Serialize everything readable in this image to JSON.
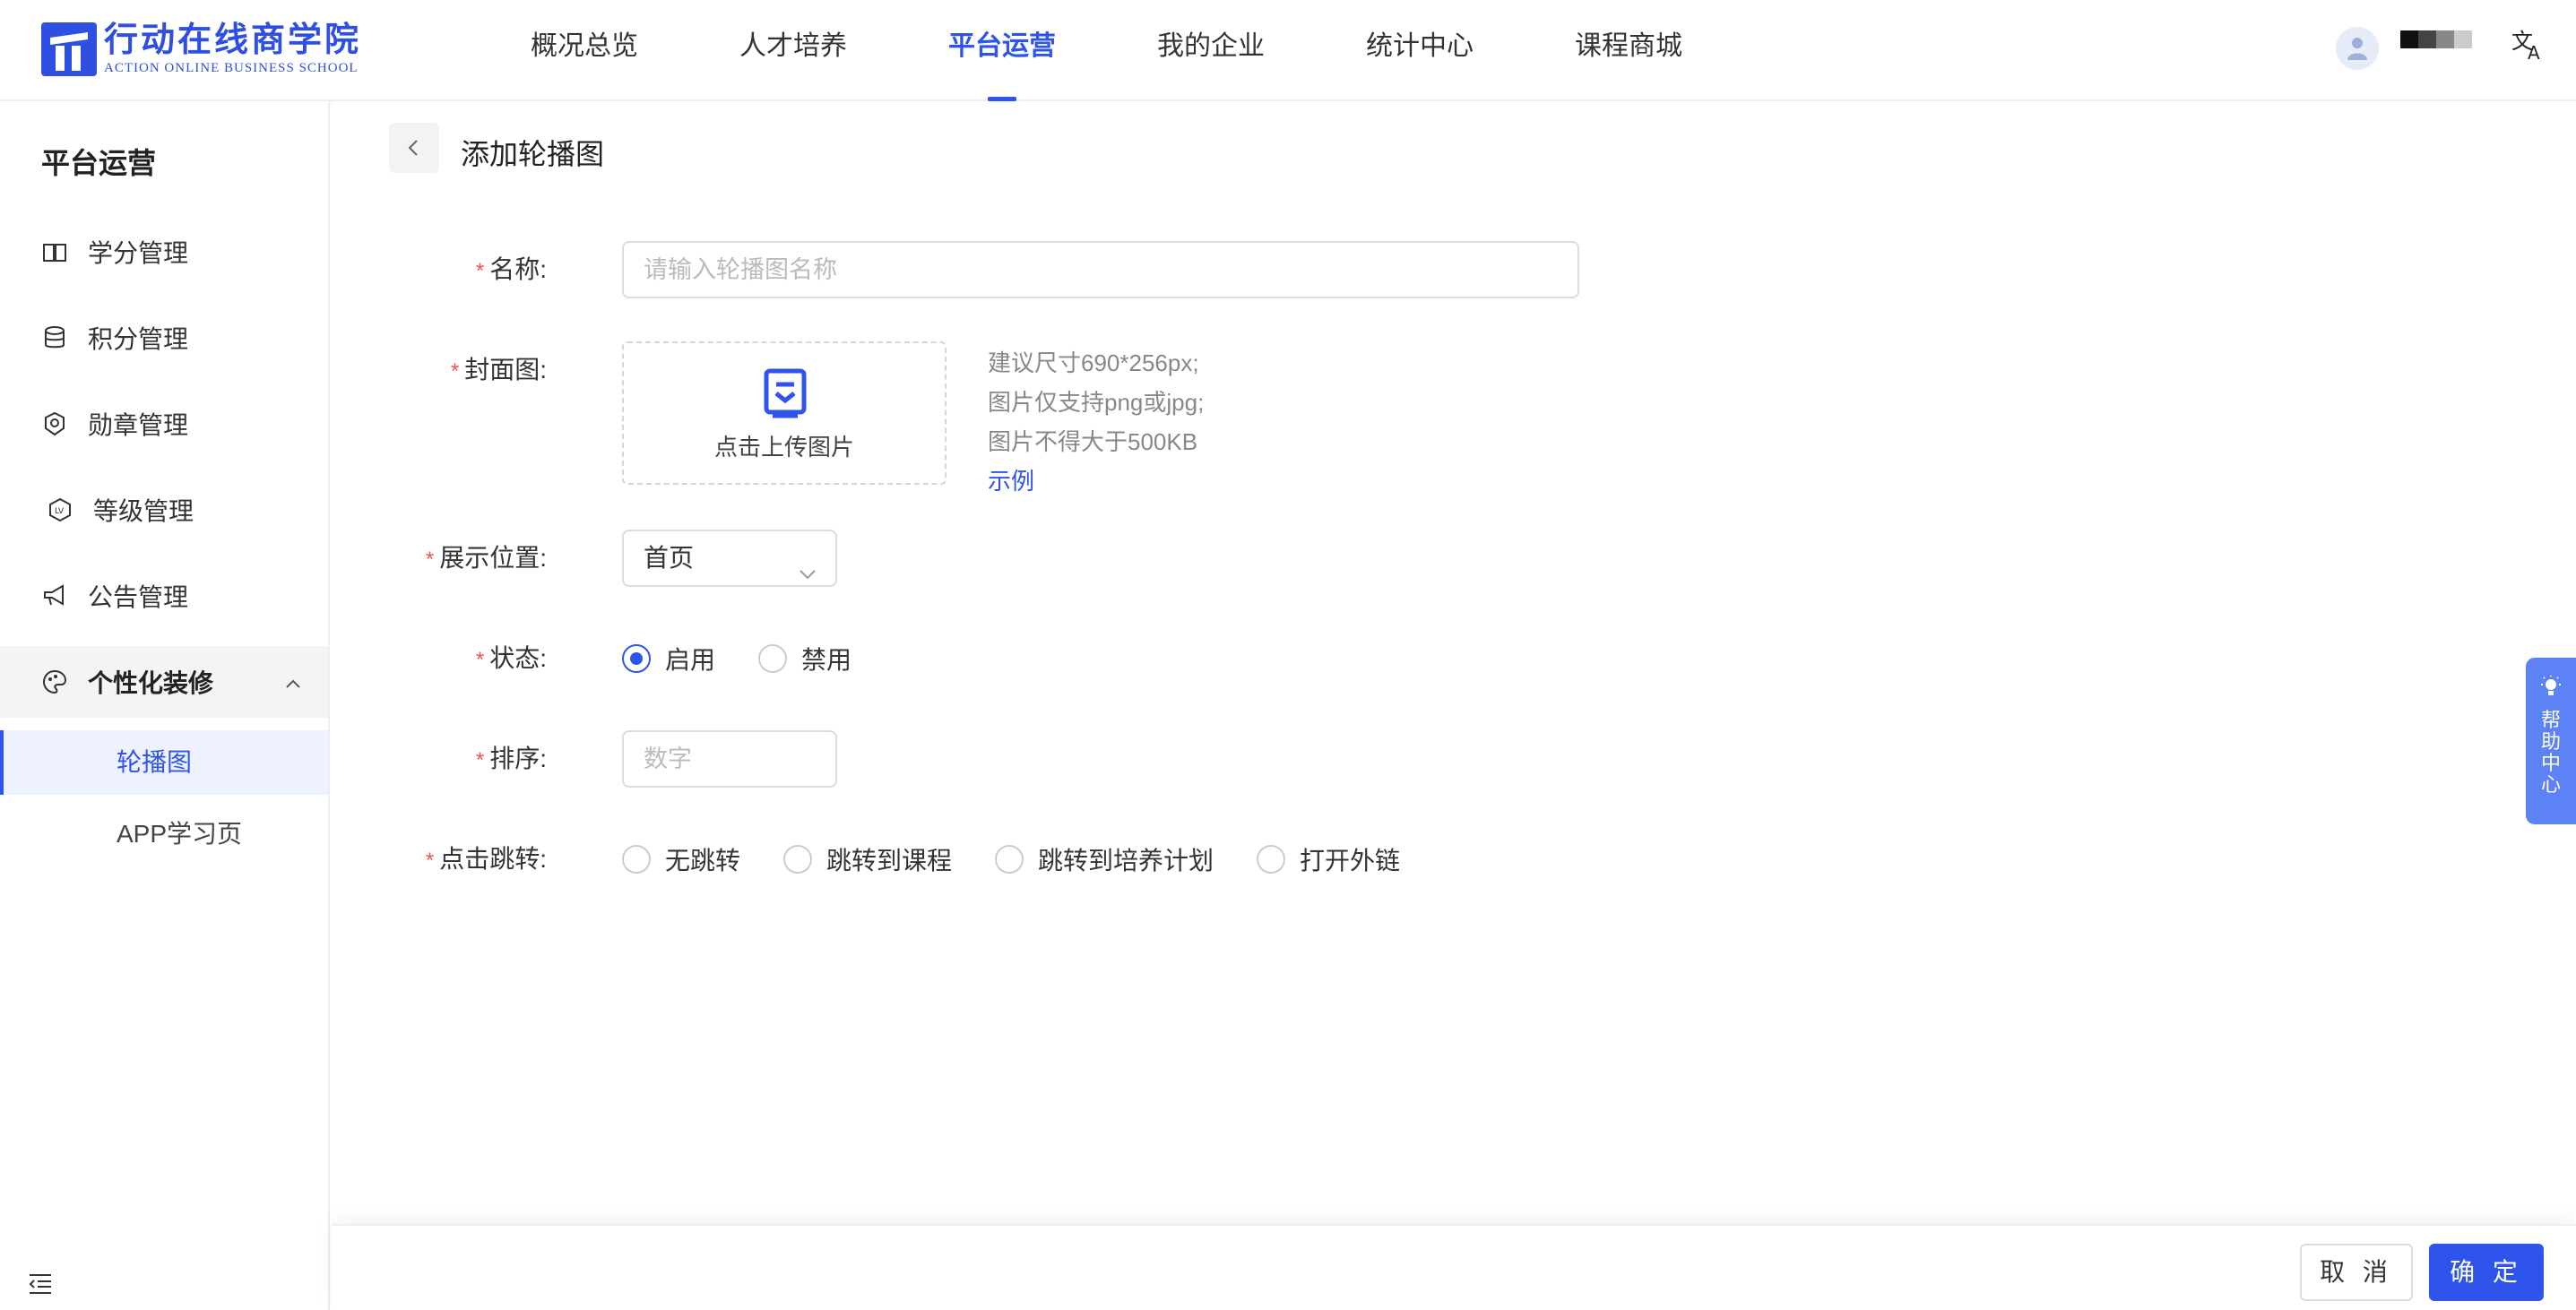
{
  "header": {
    "logo_cn": "行动在线商学院",
    "logo_en": "ACTION ONLINE BUSINESS SCHOOL",
    "nav": [
      "概况总览",
      "人才培养",
      "平台运营",
      "我的企业",
      "统计中心",
      "课程商城"
    ],
    "active_nav": "平台运营"
  },
  "sidebar": {
    "title": "平台运营",
    "items": [
      {
        "label": "学分管理",
        "icon": "book-icon"
      },
      {
        "label": "积分管理",
        "icon": "database-icon"
      },
      {
        "label": "勋章管理",
        "icon": "medal-icon"
      },
      {
        "label": "等级管理",
        "icon": "level-icon"
      },
      {
        "label": "公告管理",
        "icon": "megaphone-icon"
      }
    ],
    "group": {
      "label": "个性化装修",
      "icon": "palette-icon",
      "expanded": true
    },
    "sub_items": [
      "轮播图",
      "APP学习页"
    ],
    "active_sub": "轮播图"
  },
  "page": {
    "title": "添加轮播图"
  },
  "form": {
    "name": {
      "label": "名称:",
      "placeholder": "请输入轮播图名称"
    },
    "cover": {
      "label": "封面图:",
      "upload_text": "点击上传图片",
      "hints": [
        "建议尺寸690*256px;",
        "图片仅支持png或jpg;",
        "图片不得大于500KB"
      ],
      "example_link": "示例"
    },
    "position": {
      "label": "展示位置:",
      "value": "首页"
    },
    "status": {
      "label": "状态:",
      "options": [
        "启用",
        "禁用"
      ],
      "selected": "启用"
    },
    "sort": {
      "label": "排序:",
      "placeholder": "数字"
    },
    "jump": {
      "label": "点击跳转:",
      "options": [
        "无跳转",
        "跳转到课程",
        "跳转到培养计划",
        "打开外链"
      ],
      "selected": ""
    }
  },
  "help": {
    "text": "帮助中心"
  },
  "footer": {
    "cancel": "取 消",
    "confirm": "确 定"
  },
  "colors": {
    "primary": "#2f54eb",
    "required": "#f05050",
    "help_bg": "#5c82f5"
  }
}
